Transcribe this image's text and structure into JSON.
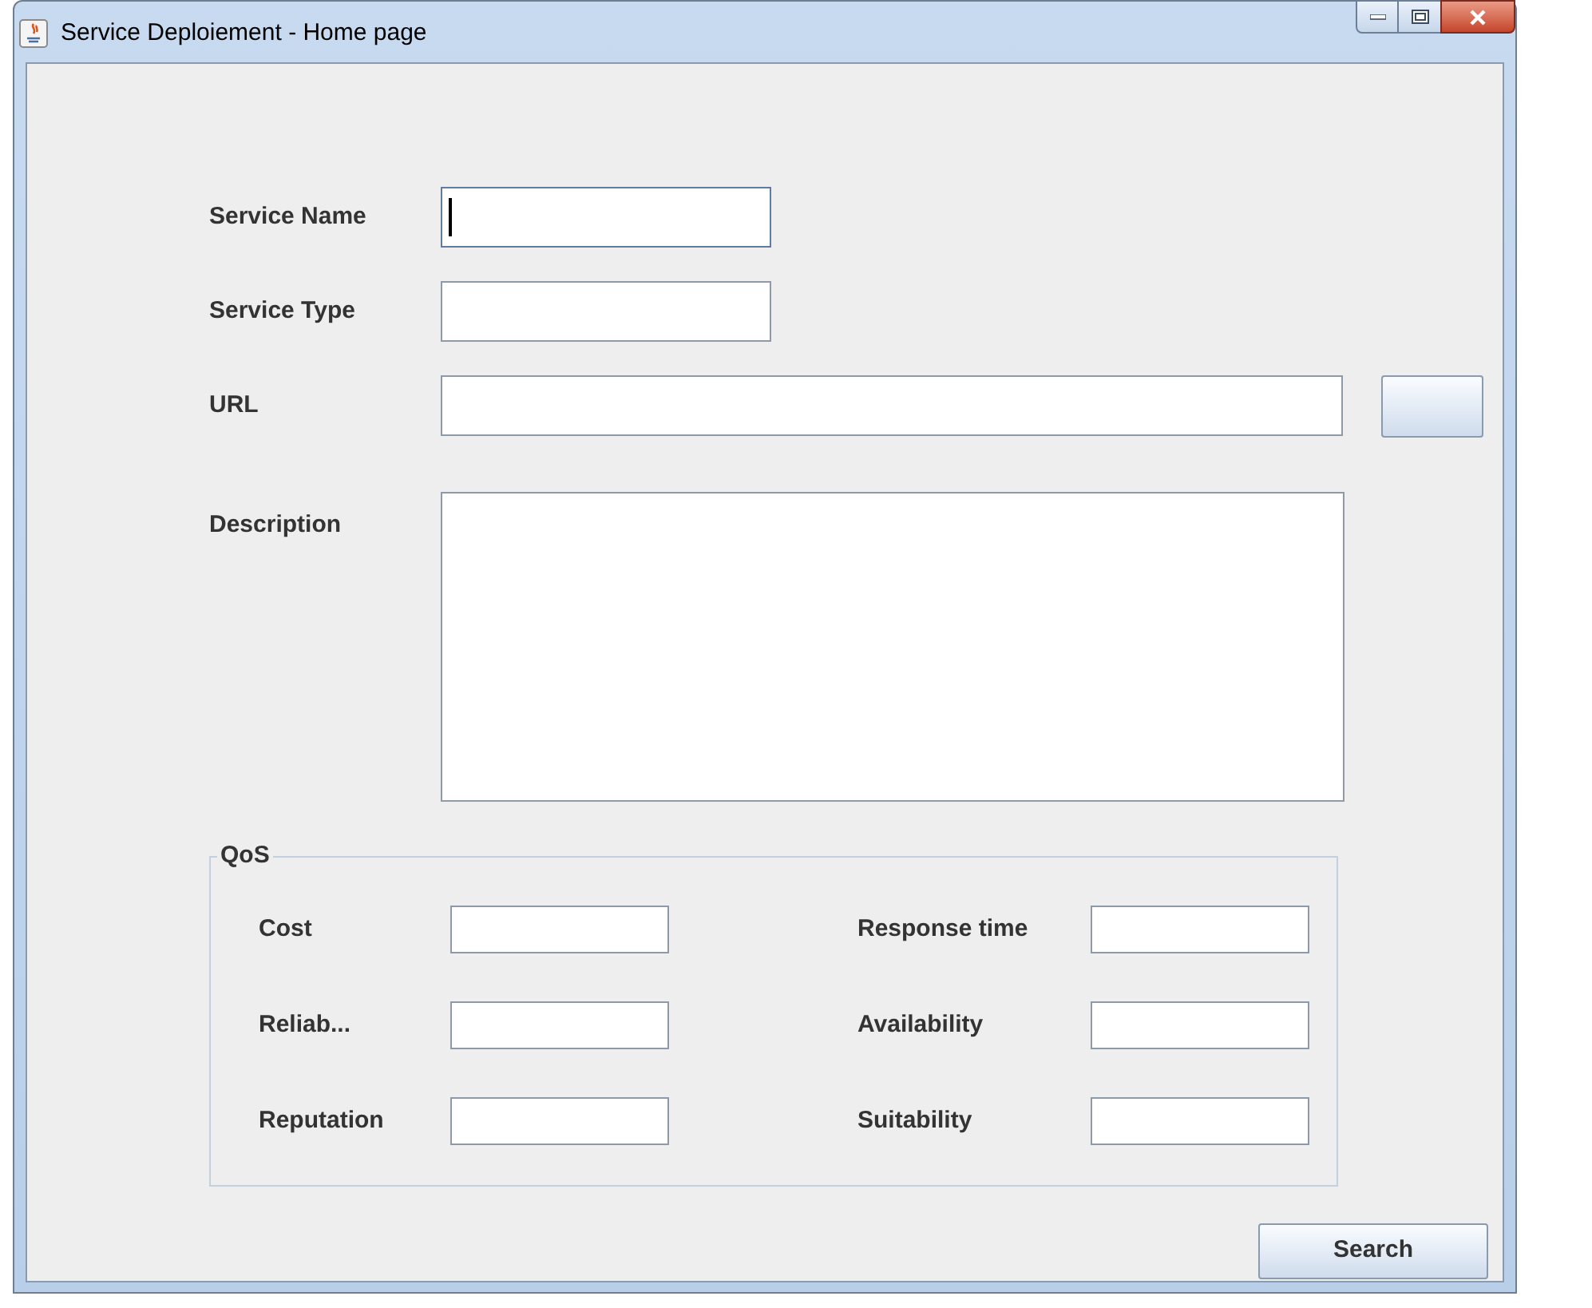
{
  "window": {
    "title": "Service Deploiement - Home page"
  },
  "fields": [
    {
      "label": "Service Name",
      "kind": "short",
      "focused": true
    },
    {
      "label": "Service Type",
      "kind": "short",
      "focused": false
    },
    {
      "label": "URL",
      "kind": "wide",
      "focused": false
    },
    {
      "label": "Description",
      "kind": "area",
      "focused": false
    }
  ],
  "qos": {
    "title": "QoS",
    "fields": [
      {
        "label": "Cost"
      },
      {
        "label": "Response time"
      },
      {
        "label": "Reliab..."
      },
      {
        "label": "Availability"
      },
      {
        "label": "Reputation"
      },
      {
        "label": "Suitability"
      }
    ]
  },
  "search_button": {
    "label": "Search"
  }
}
